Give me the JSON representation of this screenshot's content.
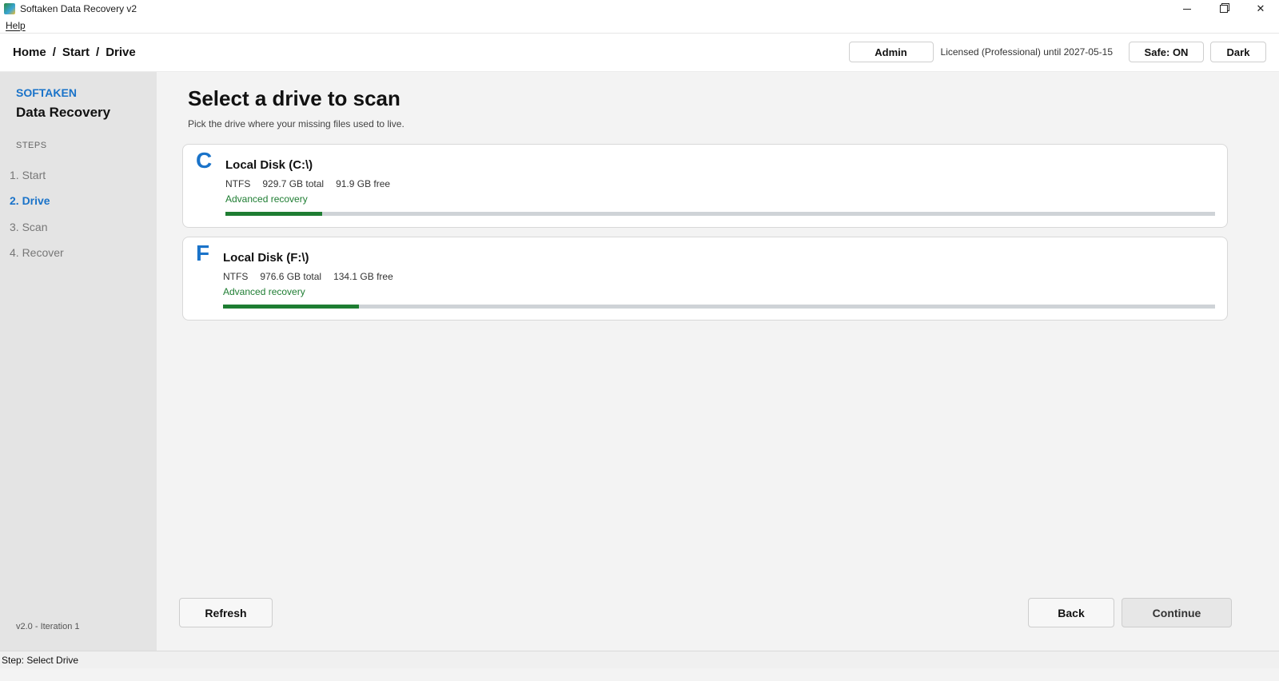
{
  "window": {
    "title": "Softaken Data Recovery v2"
  },
  "menu": {
    "help": "Help"
  },
  "breadcrumb": [
    "Home",
    "Start",
    "Drive"
  ],
  "header": {
    "admin_label": "Admin",
    "license_text": "Licensed (Professional) until 2027-05-15",
    "safe_label": "Safe: ON",
    "theme_label": "Dark"
  },
  "sidebar": {
    "brand": "SOFTAKEN",
    "product": "Data Recovery",
    "steps_heading": "STEPS",
    "steps": [
      "1. Start",
      "2. Drive",
      "3. Scan",
      "4. Recover"
    ],
    "active_step": 1,
    "version": "v2.0  -  Iteration 1"
  },
  "main": {
    "title": "Select a drive to scan",
    "subtitle": "Pick the drive where your missing files used to live."
  },
  "drives": [
    {
      "letter": "C",
      "name": "Local Disk (C:\\)",
      "fs": "NTFS",
      "total": "929.7 GB total",
      "free": "91.9 GB free",
      "mode": "Advanced recovery",
      "used_fraction": 0.098
    },
    {
      "letter": "F",
      "name": "Local Disk (F:\\)",
      "fs": "NTFS",
      "total": "976.6 GB total",
      "free": "134.1 GB free",
      "mode": "Advanced recovery",
      "used_fraction": 0.137
    }
  ],
  "footer": {
    "refresh": "Refresh",
    "back": "Back",
    "continue": "Continue"
  },
  "status": {
    "text": "Step: Select Drive"
  },
  "colors": {
    "accent": "#1a73c9",
    "success": "#1e7d32",
    "track": "#cfd3d7"
  }
}
